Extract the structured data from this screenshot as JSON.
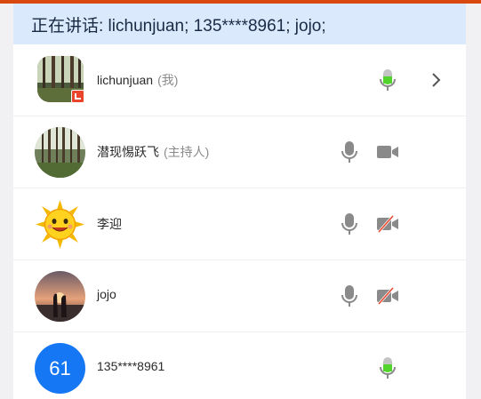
{
  "speaking": {
    "text": "正在讲话: lichunjuan; 135****8961; jojo;"
  },
  "participants": [
    {
      "name": "lichunjuan",
      "tag": "(我)",
      "mic": "mic-active",
      "camera": "none",
      "action": "chevron-right-icon",
      "avatar": "forest-photo"
    },
    {
      "name": "潜现惕跃飞",
      "tag": "(主持人)",
      "mic": "mic-idle",
      "camera": "camera-on",
      "avatar": "forest-photo"
    },
    {
      "name": "李迎",
      "tag": "",
      "mic": "mic-idle",
      "camera": "camera-off",
      "avatar": "sun-face"
    },
    {
      "name": "jojo",
      "tag": "",
      "mic": "mic-idle",
      "camera": "camera-off",
      "avatar": "sunset-couple"
    },
    {
      "name": "135****8961",
      "tag": "",
      "avatar_text": "61",
      "mic": "mic-active",
      "camera": "none",
      "avatar": "number"
    }
  ],
  "colors": {
    "accent": "#1677f5",
    "speaking_bg": "#dbe9fd",
    "mic_active": "#52d42c",
    "icon_gray": "#8a8a8a",
    "camera_off_slash": "#e8452c"
  }
}
